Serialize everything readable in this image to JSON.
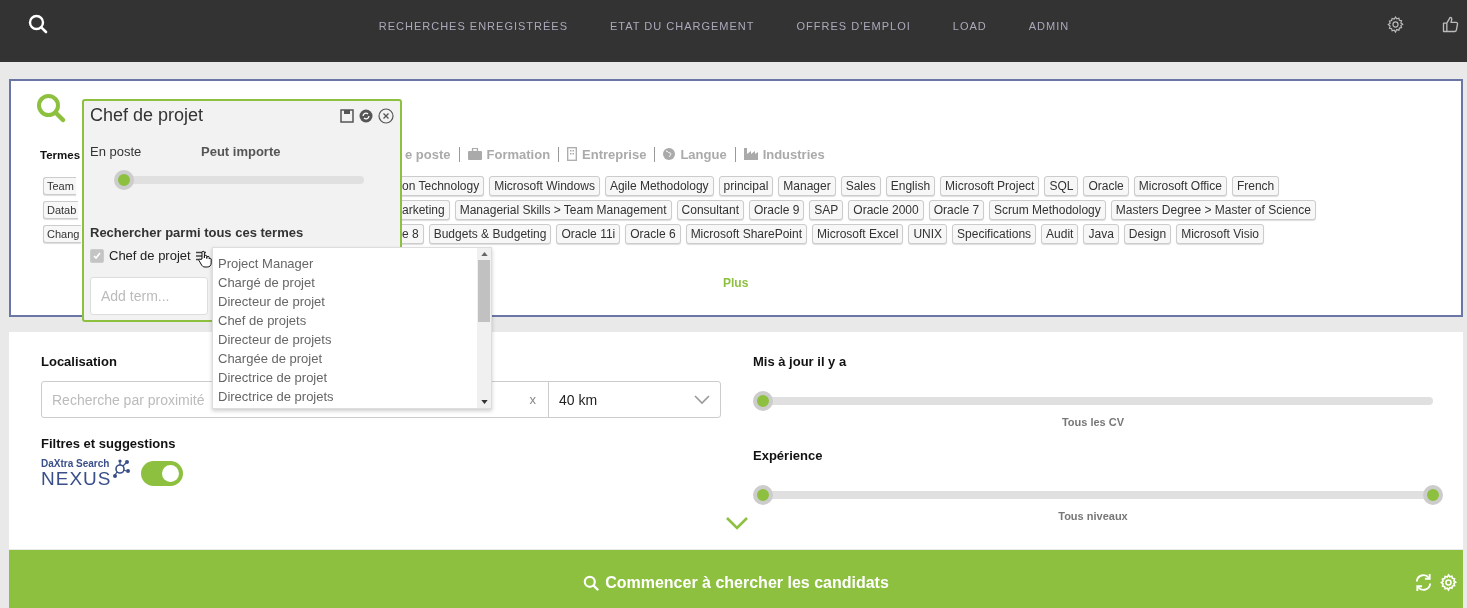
{
  "nav": {
    "items": [
      "RECHERCHES ENREGISTRÉES",
      "ETAT DU CHARGEMENT",
      "OFFRES D'EMPLOI",
      "LOAD",
      "ADMIN"
    ]
  },
  "search_card": {
    "filters_left": "Termes",
    "filters": [
      {
        "label": "e poste",
        "kind": "cut"
      },
      {
        "label": "Formation",
        "kind": "briefcase"
      },
      {
        "label": "Entreprise",
        "kind": "building"
      },
      {
        "label": "Langue",
        "kind": "globe"
      },
      {
        "label": "Industries",
        "kind": "factory"
      }
    ],
    "tag_rows": [
      {
        "left": "Team",
        "tags": [
          "on Technology",
          "Microsoft Windows",
          "Agile Methodology",
          "principal",
          "Manager",
          "Sales",
          "English",
          "Microsoft Project",
          "SQL",
          "Oracle",
          "Microsoft Office",
          "French"
        ]
      },
      {
        "left": "Datab",
        "tags": [
          "arketing",
          "Managerial Skills > Team Management",
          "Consultant",
          "Oracle 9",
          "SAP",
          "Oracle 2000",
          "Oracle 7",
          "Scrum Methodology",
          "Masters Degree > Master of Science"
        ]
      },
      {
        "left": "Chang",
        "tags": [
          "e 8",
          "Budgets & Budgeting",
          "Oracle 11i",
          "Oracle 6",
          "Microsoft SharePoint",
          "Microsoft Excel",
          "UNIX",
          "Specifications",
          "Audit",
          "Java",
          "Design",
          "Microsoft Visio"
        ]
      }
    ],
    "more": "Plus"
  },
  "term_popup": {
    "title": "Chef de projet",
    "slider_left": "En poste",
    "slider_center": "Peut importe",
    "slider": {
      "level": 0
    },
    "section": "Rechercher parmi tous ces termes",
    "term": {
      "label": "Chef de projet",
      "checked": true
    },
    "add_placeholder": "Add term..."
  },
  "suggestions": [
    "Project Manager",
    "Chargé de projet",
    "Directeur de projet",
    "Chef de projets",
    "Directeur de projets",
    "Chargée de projet",
    "Directrice de projet",
    "Directrice de projets"
  ],
  "location": {
    "label": "Localisation",
    "placeholder": "Recherche par proximité",
    "clear": "x",
    "radius": "40 km"
  },
  "filters": {
    "label": "Filtres et suggestions",
    "logo_top": "DaXtra Search",
    "logo_bottom": "NEXUS",
    "on": true
  },
  "updated": {
    "label": "Mis à jour il y a",
    "slider": {
      "level": 0
    },
    "caption": "Tous les CV"
  },
  "experience": {
    "label": "Expérience",
    "low": {
      "level": 0
    },
    "high": {
      "level": 1
    },
    "caption": "Tous niveaux"
  },
  "start_button": "Commencer à chercher les candidats"
}
